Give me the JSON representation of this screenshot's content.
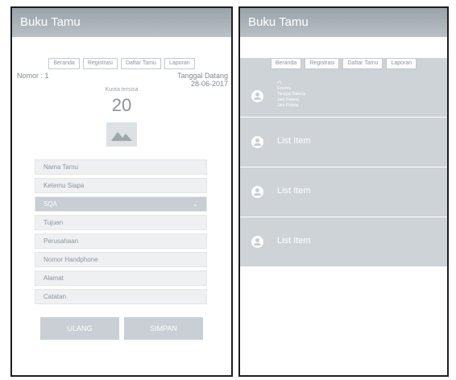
{
  "left": {
    "title": "Buku Tamu",
    "tabs": [
      "Beranda",
      "Registrasi",
      "Daftar Tamu",
      "Laporan"
    ],
    "nomor": "Nomor : 1",
    "tanggal_label": "Tanggal Datang",
    "tanggal_value": "28-06-2017",
    "kuota_label": "Kuota tersisa",
    "kuota_value": "20",
    "photo_icon": "image-placeholder-icon",
    "fields": {
      "nama": "Nama Tamu",
      "ketemu": "Ketemu Siapa",
      "sqa": "SQA",
      "tujuan": "Tujuan",
      "perusahaan": "Perusahaan",
      "nomor_hp": "Nomor Handphone",
      "alamat": "Alamat",
      "catatan": "Catatan"
    },
    "buttons": {
      "ulang": "ULANG",
      "simpan": "SIMPAN"
    }
  },
  "right": {
    "title": "Buku Tamu",
    "tabs": [
      "Beranda",
      "Registrasi",
      "Daftar Tamu",
      "Laporan"
    ],
    "first_item": {
      "lines": [
        "#1",
        "Ketemu",
        "Tanggal Datang",
        "Jam Datang",
        "Jam Pulang"
      ]
    },
    "items": [
      "List Item",
      "List Item",
      "List Item"
    ],
    "avatar_icon": "person-icon"
  },
  "colors": {
    "appbar": "#a7afb5",
    "list_bg": "#cdd3d7",
    "field_bg": "#eef0f2",
    "button_bg": "#c9cfd4"
  }
}
